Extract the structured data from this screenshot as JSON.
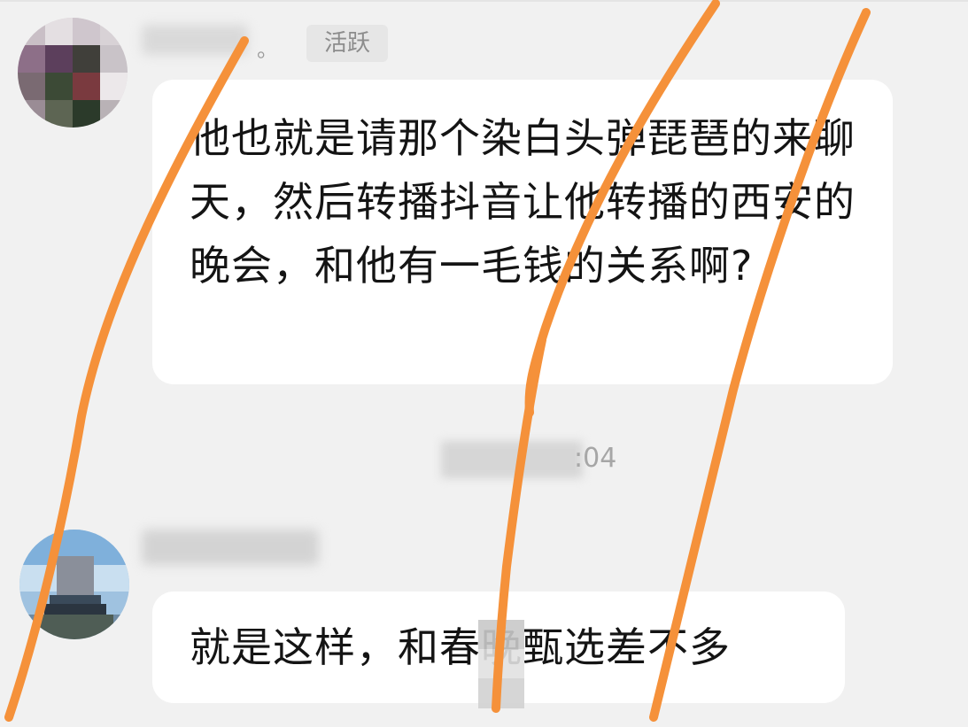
{
  "messages": [
    {
      "tail": "。",
      "badge": "活跃",
      "text": "他也就是请那个染白头弹琵琶的来聊天，然后转播抖音让他转播的西安的晚会，和他有一毛钱的关系啊?"
    },
    {
      "text": "就是这样，和春晚甄选差不多"
    }
  ],
  "timestamp_partial": ":04",
  "colors": {
    "background": "#f1f1f1",
    "bubble": "#ffffff",
    "badge_bg": "#e6e6e6",
    "badge_text": "#8c8c8c",
    "scribble": "#f5913a"
  },
  "icons": {
    "avatar_1": "avatar-icon",
    "avatar_2": "avatar-icon"
  }
}
